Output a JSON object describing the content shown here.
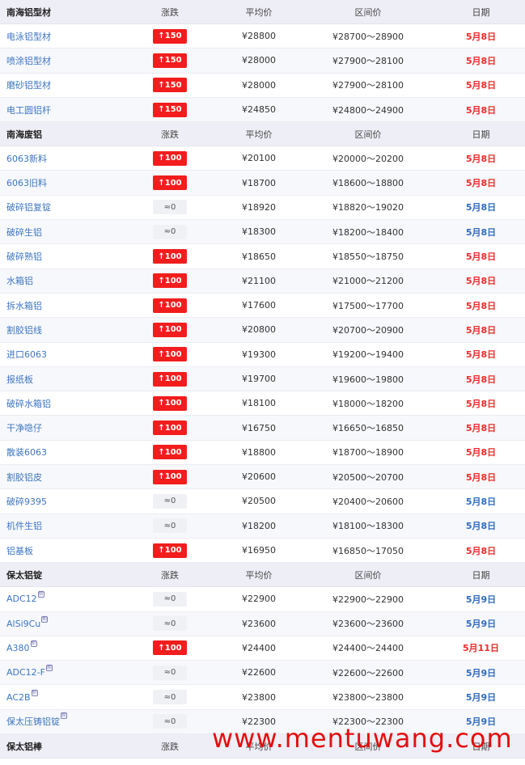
{
  "watermark_text": "www.mentuwang.com",
  "columns": [
    "涨跌",
    "平均价",
    "区间价",
    "日期"
  ],
  "sections": [
    {
      "title": "南海铝型材",
      "rows": [
        {
          "name": "电泳铝型材",
          "change": "↑150",
          "dir": "up",
          "avg": "¥28800",
          "range": "¥28700～28900",
          "date": "5月8日",
          "date_color": "red"
        },
        {
          "name": "喷涂铝型材",
          "change": "↑150",
          "dir": "up",
          "avg": "¥28000",
          "range": "¥27900～28100",
          "date": "5月8日",
          "date_color": "red"
        },
        {
          "name": "磨砂铝型材",
          "change": "↑150",
          "dir": "up",
          "avg": "¥28000",
          "range": "¥27900～28100",
          "date": "5月8日",
          "date_color": "red"
        },
        {
          "name": "电工圆铝杆",
          "change": "↑150",
          "dir": "up",
          "avg": "¥24850",
          "range": "¥24800～24900",
          "date": "5月8日",
          "date_color": "red"
        }
      ]
    },
    {
      "title": "南海废铝",
      "rows": [
        {
          "name": "6063新料",
          "change": "↑100",
          "dir": "up",
          "avg": "¥20100",
          "range": "¥20000～20200",
          "date": "5月8日",
          "date_color": "red"
        },
        {
          "name": "6063旧料",
          "change": "↑100",
          "dir": "up",
          "avg": "¥18700",
          "range": "¥18600～18800",
          "date": "5月8日",
          "date_color": "red"
        },
        {
          "name": "破碎铝复锭",
          "change": "≈0",
          "dir": "flat",
          "avg": "¥18920",
          "range": "¥18820～19020",
          "date": "5月8日",
          "date_color": "blue"
        },
        {
          "name": "破碎生铝",
          "change": "≈0",
          "dir": "flat",
          "avg": "¥18300",
          "range": "¥18200～18400",
          "date": "5月8日",
          "date_color": "blue"
        },
        {
          "name": "破碎熟铝",
          "change": "↑100",
          "dir": "up",
          "avg": "¥18650",
          "range": "¥18550～18750",
          "date": "5月8日",
          "date_color": "red"
        },
        {
          "name": "水箱铝",
          "change": "↑100",
          "dir": "up",
          "avg": "¥21100",
          "range": "¥21000～21200",
          "date": "5月8日",
          "date_color": "red"
        },
        {
          "name": "拆水箱铝",
          "change": "↑100",
          "dir": "up",
          "avg": "¥17600",
          "range": "¥17500～17700",
          "date": "5月8日",
          "date_color": "red"
        },
        {
          "name": "割胶铝线",
          "change": "↑100",
          "dir": "up",
          "avg": "¥20800",
          "range": "¥20700～20900",
          "date": "5月8日",
          "date_color": "red"
        },
        {
          "name": "进口6063",
          "change": "↑100",
          "dir": "up",
          "avg": "¥19300",
          "range": "¥19200～19400",
          "date": "5月8日",
          "date_color": "red"
        },
        {
          "name": "报纸板",
          "change": "↑100",
          "dir": "up",
          "avg": "¥19700",
          "range": "¥19600～19800",
          "date": "5月8日",
          "date_color": "red"
        },
        {
          "name": "破碎水箱铝",
          "change": "↑100",
          "dir": "up",
          "avg": "¥18100",
          "range": "¥18000～18200",
          "date": "5月8日",
          "date_color": "red"
        },
        {
          "name": "干净喼仔",
          "change": "↑100",
          "dir": "up",
          "avg": "¥16750",
          "range": "¥16650～16850",
          "date": "5月8日",
          "date_color": "red"
        },
        {
          "name": "散装6063",
          "change": "↑100",
          "dir": "up",
          "avg": "¥18800",
          "range": "¥18700～18900",
          "date": "5月8日",
          "date_color": "red"
        },
        {
          "name": "割胶铝皮",
          "change": "↑100",
          "dir": "up",
          "avg": "¥20600",
          "range": "¥20500～20700",
          "date": "5月8日",
          "date_color": "red"
        },
        {
          "name": "破碎9395",
          "change": "≈0",
          "dir": "flat",
          "avg": "¥20500",
          "range": "¥20400～20600",
          "date": "5月8日",
          "date_color": "blue"
        },
        {
          "name": "机件生铝",
          "change": "≈0",
          "dir": "flat",
          "avg": "¥18200",
          "range": "¥18100～18300",
          "date": "5月8日",
          "date_color": "blue"
        },
        {
          "name": "铝基板",
          "change": "↑100",
          "dir": "up",
          "avg": "¥16950",
          "range": "¥16850～17050",
          "date": "5月8日",
          "date_color": "red"
        }
      ]
    },
    {
      "title": "保太铝锭",
      "rows": [
        {
          "name": "ADC12",
          "new_mark": "新",
          "change": "≈0",
          "dir": "flat",
          "avg": "¥22900",
          "range": "¥22900～22900",
          "date": "5月9日",
          "date_color": "blue"
        },
        {
          "name": "AlSi9Cu",
          "new_mark": "新",
          "change": "≈0",
          "dir": "flat",
          "avg": "¥23600",
          "range": "¥23600～23600",
          "date": "5月9日",
          "date_color": "blue"
        },
        {
          "name": "A380",
          "new_mark": "新",
          "change": "↑100",
          "dir": "up",
          "avg": "¥24400",
          "range": "¥24400～24400",
          "date": "5月11日",
          "date_color": "red"
        },
        {
          "name": "ADC12-F",
          "new_mark": "新",
          "change": "≈0",
          "dir": "flat",
          "avg": "¥22600",
          "range": "¥22600～22600",
          "date": "5月9日",
          "date_color": "blue"
        },
        {
          "name": "AC2B",
          "new_mark": "新",
          "change": "≈0",
          "dir": "flat",
          "avg": "¥23800",
          "range": "¥23800～23800",
          "date": "5月9日",
          "date_color": "blue"
        },
        {
          "name": "保太压铸铝锭",
          "new_mark": "新",
          "change": "≈0",
          "dir": "flat",
          "avg": "¥22300",
          "range": "¥22300～22300",
          "date": "5月9日",
          "date_color": "blue"
        }
      ]
    },
    {
      "title": "保太铝棒",
      "rows": []
    }
  ]
}
